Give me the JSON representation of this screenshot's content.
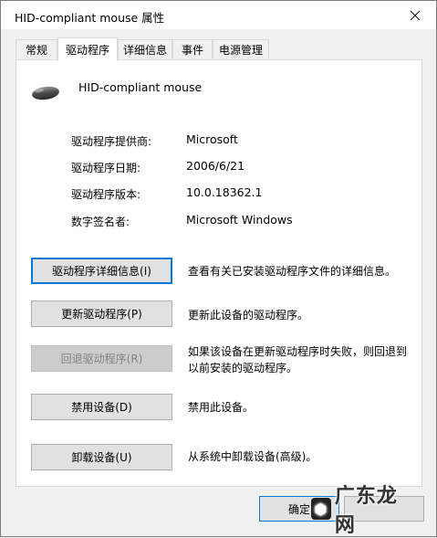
{
  "window": {
    "title": "HID-compliant mouse 属性"
  },
  "tabs": [
    {
      "label": "常规",
      "active": false
    },
    {
      "label": "驱动程序",
      "active": true
    },
    {
      "label": "详细信息",
      "active": false
    },
    {
      "label": "事件",
      "active": false
    },
    {
      "label": "电源管理",
      "active": false
    }
  ],
  "device": {
    "name": "HID-compliant mouse",
    "icon": "mouse-icon"
  },
  "properties": [
    {
      "label": "驱动程序提供商:",
      "value": "Microsoft"
    },
    {
      "label": "驱动程序日期:",
      "value": "2006/6/21"
    },
    {
      "label": "驱动程序版本:",
      "value": "10.0.18362.1"
    },
    {
      "label": "数字签名者:",
      "value": "Microsoft Windows"
    }
  ],
  "actions": [
    {
      "label": "驱动程序详细信息(I)",
      "description": "查看有关已安装驱动程序文件的详细信息。",
      "enabled": true
    },
    {
      "label": "更新驱动程序(P)",
      "description": "更新此设备的驱动程序。",
      "enabled": true
    },
    {
      "label": "回退驱动程序(R)",
      "description": "如果该设备在更新驱动程序时失败，则回退到以前安装的驱动程序。",
      "enabled": false
    },
    {
      "label": "禁用设备(D)",
      "description": "禁用此设备。",
      "enabled": true
    },
    {
      "label": "卸载设备(U)",
      "description": "从系统中卸载设备(高级)。",
      "enabled": true
    }
  ],
  "footer": {
    "ok_label": "确定"
  },
  "watermark": {
    "text": "广东龙网"
  },
  "colors": {
    "focus_border": "#0078d7",
    "panel_bg": "#ffffff",
    "window_bg": "#f0f0f0"
  }
}
